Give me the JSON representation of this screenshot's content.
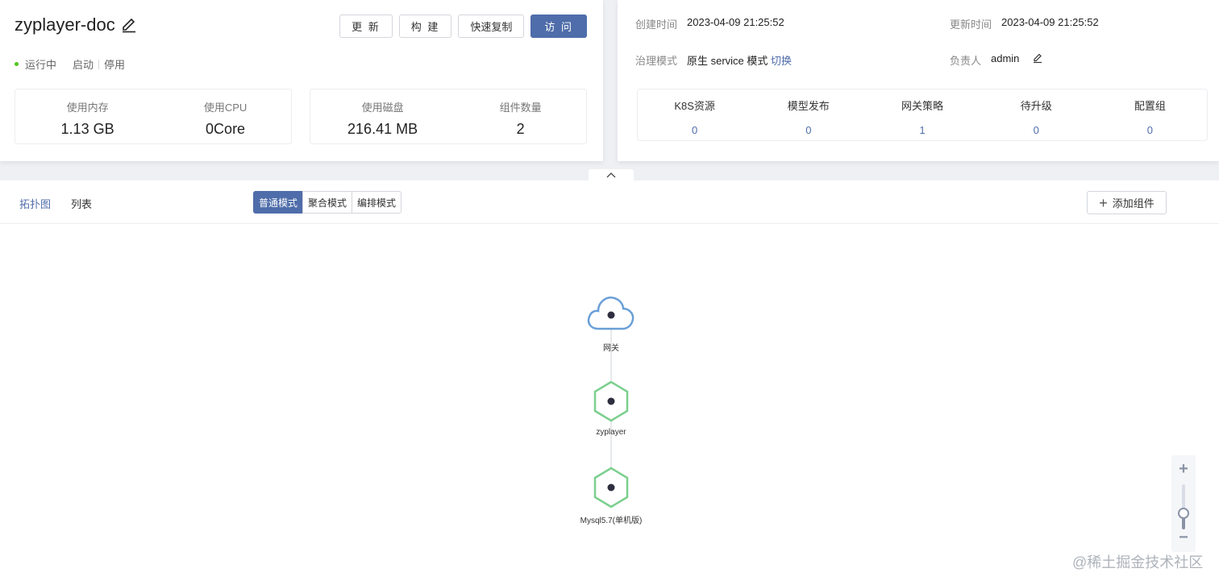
{
  "app": {
    "name": "zyplayer-doc",
    "status": "运行中",
    "actions": {
      "start": "启动",
      "stop": "停用"
    }
  },
  "toolbar": {
    "update": "更 新",
    "build": "构 建",
    "quick_copy": "快速复制",
    "visit": "访 问"
  },
  "metrics": [
    {
      "label": "使用内存",
      "value": "1.13 GB"
    },
    {
      "label": "使用CPU",
      "value": "0Core"
    },
    {
      "label": "使用磁盘",
      "value": "216.41 MB"
    },
    {
      "label": "组件数量",
      "value": "2"
    }
  ],
  "info": {
    "created_label": "创建时间",
    "created_value": "2023-04-09 21:25:52",
    "updated_label": "更新时间",
    "updated_value": "2023-04-09 21:25:52",
    "governance_label": "治理模式",
    "governance_value": "原生 service 模式",
    "governance_switch": "切换",
    "owner_label": "负责人",
    "owner_value": "admin"
  },
  "stats": [
    {
      "label": "K8S资源",
      "value": "0"
    },
    {
      "label": "模型发布",
      "value": "0"
    },
    {
      "label": "网关策略",
      "value": "1"
    },
    {
      "label": "待升级",
      "value": "0"
    },
    {
      "label": "配置组",
      "value": "0"
    }
  ],
  "view_tabs": {
    "topology": "拓扑图",
    "list": "列表"
  },
  "modes": [
    "普通模式",
    "聚合模式",
    "编排模式"
  ],
  "add_component": "添加组件",
  "topology": {
    "nodes": [
      {
        "name": "网关",
        "type": "gateway"
      },
      {
        "name": "zyplayer",
        "type": "component"
      },
      {
        "name": "Mysql5.7(单机版)",
        "type": "component"
      }
    ]
  },
  "zoom": {
    "level": 0.35
  },
  "watermark": "@稀土掘金技术社区",
  "colors": {
    "primary": "#4f6daa",
    "running": "#52c41a",
    "gateway_stroke": "#6a9fd8",
    "component_stroke": "#7ccf8e"
  }
}
